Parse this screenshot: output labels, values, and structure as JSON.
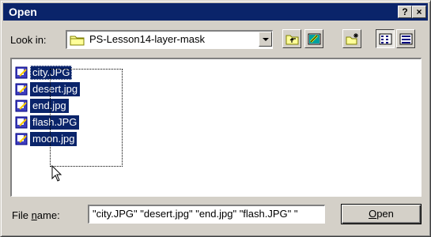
{
  "window": {
    "title": "Open",
    "help_label": "?",
    "close_label": "×"
  },
  "lookin": {
    "label": "Look in:",
    "current_folder": "PS-Lesson14-layer-mask"
  },
  "toolbar": {
    "buttons": [
      {
        "name": "up-folder-icon"
      },
      {
        "name": "desktop-icon"
      },
      {
        "name": "new-folder-icon"
      },
      {
        "name": "list-view-icon"
      },
      {
        "name": "details-view-icon"
      }
    ]
  },
  "files": [
    {
      "name": "city.JPG",
      "selected": true,
      "focused": true
    },
    {
      "name": "desert.jpg",
      "selected": true
    },
    {
      "name": "end.jpg",
      "selected": true
    },
    {
      "name": "flash.JPG",
      "selected": true
    },
    {
      "name": "moon.jpg",
      "selected": true
    }
  ],
  "filename": {
    "label": "File name:",
    "value": "\"city.JPG\" \"desert.jpg\" \"end.jpg\" \"flash.JPG\" \""
  },
  "open_button": {
    "label": "Open"
  },
  "colors": {
    "selection": "#0a246a",
    "titlebar": "#0a246a",
    "face": "#d4d0c8"
  }
}
